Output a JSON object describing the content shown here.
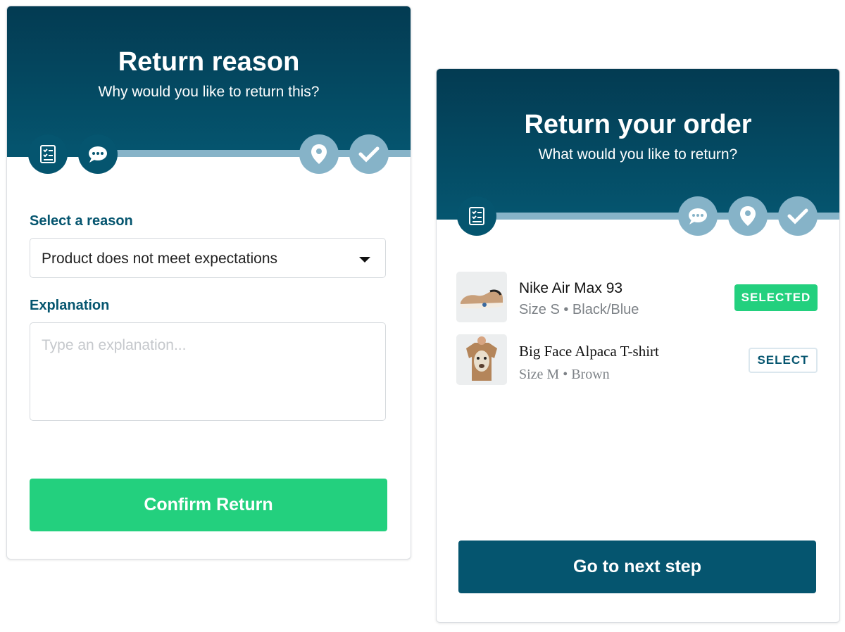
{
  "return_reason": {
    "title": "Return reason",
    "subtitle": "Why would you like to return this?",
    "steps": [
      {
        "icon": "list-icon",
        "state": "active"
      },
      {
        "icon": "chat-icon",
        "state": "active"
      },
      {
        "icon": "location-pin-icon",
        "state": "inactive"
      },
      {
        "icon": "checkmark-icon",
        "state": "inactive"
      }
    ],
    "reason_label": "Select a reason",
    "reason_value": "Product does not meet expectations",
    "explanation_label": "Explanation",
    "explanation_placeholder": "Type an explanation...",
    "confirm_label": "Confirm Return"
  },
  "return_order": {
    "title": "Return your order",
    "subtitle": "What would you like to return?",
    "steps": [
      {
        "icon": "list-icon",
        "state": "active"
      },
      {
        "icon": "chat-icon",
        "state": "inactive"
      },
      {
        "icon": "location-pin-icon",
        "state": "inactive"
      },
      {
        "icon": "checkmark-icon",
        "state": "inactive"
      }
    ],
    "items": [
      {
        "name": "Nike Air Max 93",
        "meta": "Size S • Black/Blue",
        "action": "SELECTED"
      },
      {
        "name": "Big Face Alpaca T-shirt",
        "meta": "Size M • Brown",
        "action": "SELECT"
      }
    ],
    "next_label": "Go to next step"
  },
  "colors": {
    "primary": "#05556f",
    "primary_light": "#86b3c8",
    "success": "#23d07e"
  }
}
